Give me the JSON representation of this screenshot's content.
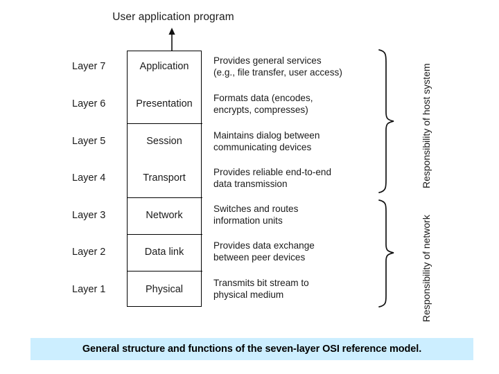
{
  "diagram": {
    "top_heading": "User application program",
    "arrow": "up-arrow",
    "layers": [
      {
        "number": "Layer 7",
        "name": "Application",
        "description": "Provides general services\n(e.g., file transfer, user access)"
      },
      {
        "number": "Layer 6",
        "name": "Presentation",
        "description": "Formats data (encodes,\nencrypts, compresses)"
      },
      {
        "number": "Layer 5",
        "name": "Session",
        "description": "Maintains dialog between\ncommunicating devices"
      },
      {
        "number": "Layer 4",
        "name": "Transport",
        "description": "Provides reliable end-to-end\ndata transmission"
      },
      {
        "number": "Layer 3",
        "name": "Network",
        "description": "Switches and routes\ninformation units"
      },
      {
        "number": "Layer 2",
        "name": "Data link",
        "description": "Provides data exchange\nbetween peer devices"
      },
      {
        "number": "Layer 1",
        "name": "Physical",
        "description": "Transmits bit stream to\nphysical medium"
      }
    ],
    "groups": [
      {
        "label": "Responsibility of host system"
      },
      {
        "label": "Responsibility of network"
      }
    ]
  },
  "caption": {
    "text": "General structure and functions of the seven-layer OSI reference model.",
    "background_color": "#cceeff"
  }
}
